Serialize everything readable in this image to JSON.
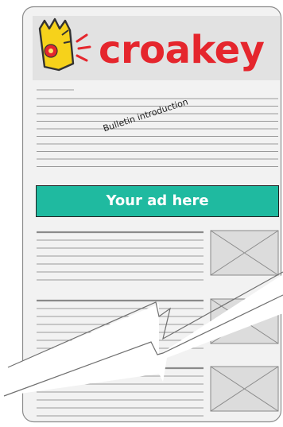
{
  "brand": {
    "name": "croakey",
    "color": "#e5262d",
    "logo_icon": "crowned-mascot-shouting-icon"
  },
  "bulletin": {
    "intro_label": "Bulletin introduction"
  },
  "ad": {
    "label": "Your ad here",
    "color": "#1fbaa0"
  },
  "stories": [
    {
      "image_placeholder": "image-placeholder-icon"
    },
    {
      "image_placeholder": "image-placeholder-icon"
    },
    {
      "image_placeholder": "image-placeholder-icon"
    }
  ],
  "colors": {
    "paper": "#f2f2f2",
    "header_band": "#e2e2e2",
    "rule": "#9a9a9a",
    "story_title_rule": "#8a8a8a",
    "placeholder_fill": "#dcdcdc"
  }
}
